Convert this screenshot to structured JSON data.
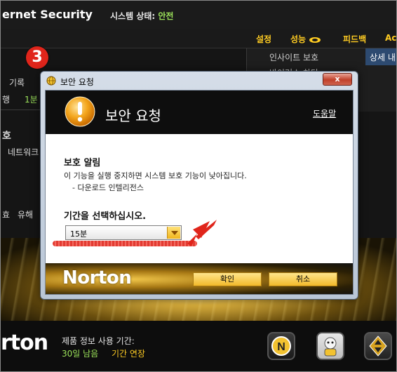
{
  "app": {
    "title": "ernet Security",
    "system_status_label": "시스템 상태:",
    "system_status_value": "안전",
    "menu": [
      "설정",
      "성능",
      "피드백",
      "Ac"
    ],
    "right_panel": {
      "item1": "인사이트 보호",
      "item2": "바이러스 차단",
      "detail_button": "상세 내"
    },
    "left_fragments": {
      "record": "기록",
      "row": "행",
      "minute": "1분",
      "protect": "호",
      "network": "네트워크",
      "fragment_a": "효",
      "fragment_b": "유해"
    },
    "bottom": {
      "logo": "rton",
      "product_info": "제품 정보 사용 기간:",
      "days_left": "30일 남음",
      "extend": "기간 연장"
    }
  },
  "annotation": {
    "step_number": "3"
  },
  "dialog": {
    "window_title": "보안 요청",
    "close_label": "x",
    "header_title": "보안 요청",
    "help_link": "도움말",
    "alert_heading": "보호 알림",
    "alert_message": "이 기능을 실행 중지하면 시스템 보호 기능이 낮아집니다.",
    "alert_sub": "- 다운로드 인텔리전스",
    "period_label": "기간을 선택하십시오.",
    "period_select": {
      "selected": "15분"
    },
    "logo_text": "Norton",
    "confirm_button": "확인",
    "cancel_button": "취소"
  },
  "colors": {
    "accent_yellow": "#ffcc22",
    "status_green": "#9ce35a",
    "annotation_red": "#e0251b"
  }
}
